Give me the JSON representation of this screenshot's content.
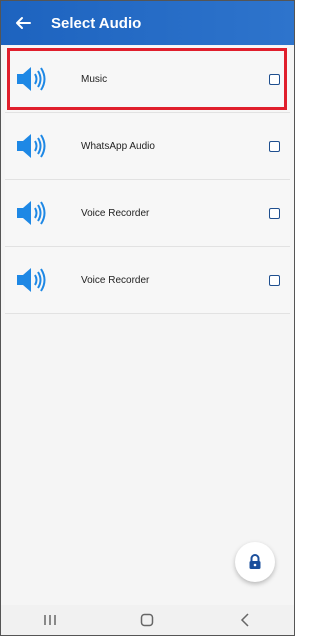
{
  "header": {
    "title": "Select Audio",
    "back_icon": "arrow-left-icon"
  },
  "colors": {
    "appbar": "#2a6fc6",
    "selection_border": "#e01f2c",
    "speaker": "#1e88e5",
    "checkbox": "#1f4f8f"
  },
  "items": [
    {
      "label": "Music",
      "icon": "speaker-icon",
      "checked": false,
      "highlighted": true
    },
    {
      "label": "WhatsApp Audio",
      "icon": "speaker-icon",
      "checked": false,
      "highlighted": false
    },
    {
      "label": "Voice Recorder",
      "icon": "speaker-icon",
      "checked": false,
      "highlighted": false
    },
    {
      "label": "Voice Recorder",
      "icon": "speaker-icon",
      "checked": false,
      "highlighted": false
    }
  ],
  "fab": {
    "icon": "lock-icon"
  },
  "navbar": {
    "recents_icon": "recents-icon",
    "home_icon": "home-icon",
    "back_icon": "back-chevron-icon"
  }
}
